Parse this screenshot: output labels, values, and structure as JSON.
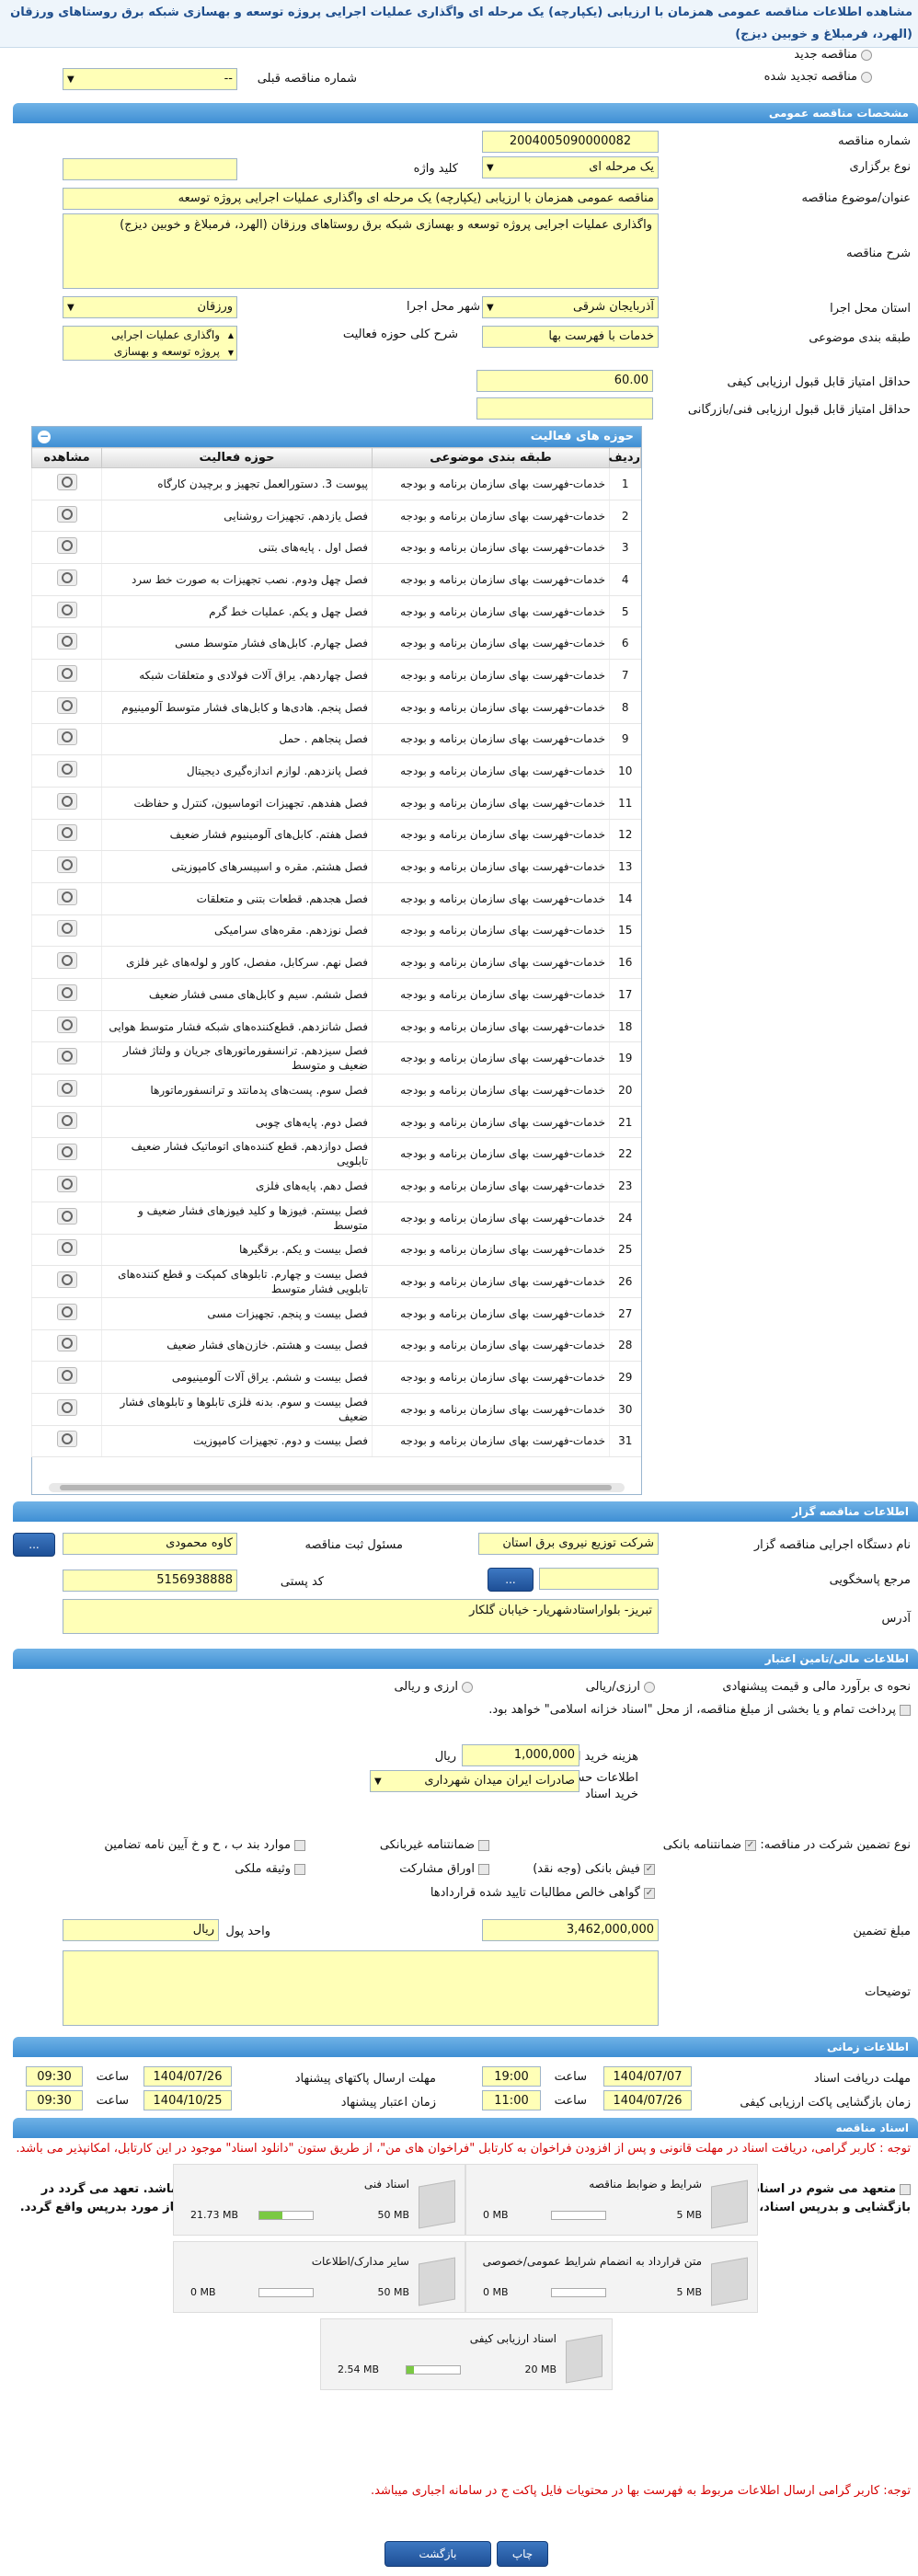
{
  "title": "مشاهده اطلاعات مناقصه عمومی همزمان با ارزیابی (یکپارچه) یک مرحله ای واگذاری عملیات اجرایی پروژه توسعه و بهسازی شبکه برق روستاهای ورزقان (الهرد، فرمبلاغ و خوبین دیزج)",
  "top": {
    "new_tender": "مناقصه جدید",
    "renewed_tender": "مناقصه تجدید شده",
    "prev_number_label": "شماره مناقصه قبلی",
    "prev_number_value": "--"
  },
  "general": {
    "section": "مشخصات مناقصه عمومی",
    "number_label": "شماره مناقصه",
    "number": "2004005090000082",
    "type_label": "نوع برگزاری",
    "type": "یک مرحله ای",
    "keyword_label": "کلید واژه",
    "subject_label": "عنوان/موضوع مناقصه",
    "subject": "مناقصه عمومی همزمان با ارزیابی (یکپارچه) یک مرحله ای واگذاری عملیات اجرایی پروژه توسعه",
    "desc_label": "شرح مناقصه",
    "desc": "واگذاری عملیات اجرایی پروژه توسعه و بهسازی شبکه برق روستاهای ورزقان (الهرد، فرمبلاغ و خوبین دیزج)",
    "province_label": "استان محل اجرا",
    "province": "آذربایجان شرقی",
    "city_label": "شهر محل اجرا",
    "city": "ورزقان",
    "category_label": "طبقه بندی موضوعی",
    "category": "خدمات با فهرست بها",
    "scope_label": "شرح کلی حوزه فعالیت",
    "scope_1": "واگذاری عملیات اجرایی",
    "scope_2": "پروژه توسعه و بهسازی",
    "min_quality_label": "حداقل امتیاز قابل قبول ارزیابی کیفی",
    "min_quality": "60.00",
    "min_tech_label": "حداقل امتیاز قابل قبول ارزیابی فنی/بازرگانی"
  },
  "activities": {
    "title": "حوزه های فعالیت",
    "col_row": "ردیف",
    "col_category": "طبقه بندی موضوعی",
    "col_field": "حوزه فعالیت",
    "col_view": "مشاهده",
    "category_text": "خدمات-فهرست بهای سازمان برنامه و بودجه",
    "rows": [
      {
        "n": "1",
        "f": "پیوست 3. دستورالعمل تجهیز و برچیدن کارگاه"
      },
      {
        "n": "2",
        "f": "فصل یازدهم. تجهیزات روشنایی"
      },
      {
        "n": "3",
        "f": "فصل اول . پایه‌های بتنی"
      },
      {
        "n": "4",
        "f": "فصل چهل ودوم. نصب تجهیزات به صورت خط سرد"
      },
      {
        "n": "5",
        "f": "فصل چهل و یکم. عملیات خط گرم"
      },
      {
        "n": "6",
        "f": "فصل چهارم. کابل‌های فشار متوسط مسی"
      },
      {
        "n": "7",
        "f": "فصل چهاردهم. یراق آلات فولادی و متعلقات شبکه"
      },
      {
        "n": "8",
        "f": "فصل پنجم. هادی‌ها و کابل‌های فشار متوسط آلومینیوم"
      },
      {
        "n": "9",
        "f": "فصل پنجاهم . حمل"
      },
      {
        "n": "10",
        "f": "فصل پانزدهم. لوازم اندازه‌گیری دیجیتال"
      },
      {
        "n": "11",
        "f": "فصل هفدهم. تجهیزات اتوماسیون، کنترل و حفاظت"
      },
      {
        "n": "12",
        "f": "فصل هفتم. کابل‌های آلومینیوم فشار ضعیف"
      },
      {
        "n": "13",
        "f": "فصل هشتم. مقره و اسپیسرهای کامپوزیتی"
      },
      {
        "n": "14",
        "f": "فصل هجدهم. قطعات بتنی و متعلقات"
      },
      {
        "n": "15",
        "f": "فصل نوزدهم. مقره‌های سرامیکی"
      },
      {
        "n": "16",
        "f": "فصل نهم. سرکابل، مفصل، کاور و لوله‌های غیر فلزی"
      },
      {
        "n": "17",
        "f": "فصل ششم. سیم و کابل‌های مسی فشار ضعیف"
      },
      {
        "n": "18",
        "f": "فصل شانزدهم. قطع‌کننده‌های شبکه فشار متوسط هوایی"
      },
      {
        "n": "19",
        "f": "فصل سیزدهم. ترانسفورماتورهای جریان و ولتاژ فشار ضعیف و متوسط"
      },
      {
        "n": "20",
        "f": "فصل سوم. پست‌های پدمانتد و ترانسفورماتورها"
      },
      {
        "n": "21",
        "f": "فصل دوم. پایه‌های چوبی"
      },
      {
        "n": "22",
        "f": "فصل دوازدهم. قطع کننده‌های اتوماتیک فشار ضعیف تابلویی"
      },
      {
        "n": "23",
        "f": "فصل دهم. پایه‌های فلزی"
      },
      {
        "n": "24",
        "f": "فصل بیستم. فیوزها و کلید فیوزهای فشار ضعیف و متوسط"
      },
      {
        "n": "25",
        "f": "فصل بیست و یکم. برقگیرها"
      },
      {
        "n": "26",
        "f": "فصل بیست و چهارم. تابلوهای کمپکت و قطع کننده‌های تابلویی فشار متوسط"
      },
      {
        "n": "27",
        "f": "فصل بیست و پنجم. تجهیزات مسی"
      },
      {
        "n": "28",
        "f": "فصل بیست و هشتم. خازن‌های فشار ضعیف"
      },
      {
        "n": "29",
        "f": "فصل بیست و ششم. یراق آلات آلومینیومی"
      },
      {
        "n": "30",
        "f": "فصل بیست و سوم. بدنه فلزی تابلوها و تابلوهای فشار ضعیف"
      },
      {
        "n": "31",
        "f": "فصل بیست و دوم. تجهیزات کامپوزیت"
      }
    ]
  },
  "organizer": {
    "section": "اطلاعات مناقصه گزار",
    "org_label": "نام دستگاه اجرایی مناقصه گزار",
    "org": "شرکت توزیع نیروی برق استان",
    "officer_label": "مسئول ثبت مناقصه",
    "officer": "کاوه محمودی",
    "ref_label": "مرجع پاسخگویی",
    "postal_label": "کد پستی",
    "postal": "5156938888",
    "address_label": "آدرس",
    "address": "تبریز- بلواراستادشهریار- خیابان گلکار",
    "more_btn": "..."
  },
  "financial": {
    "section": "اطلاعات مالی/تامین اعتبار",
    "estimate_label": "نحوه ی برآورد مالی و قیمت پیشنهادی",
    "opt_rial": "ارزی/ریالی",
    "opt_forex": "ارزی و ریالی",
    "payment_note": "پرداخت تمام و یا بخشی از مبلغ مناقصه، از محل \"اسناد خزانه اسلامی\" خواهد بود.",
    "doc_fee_label": "هزینه خرید اسناد",
    "doc_fee": "1,000,000",
    "unit_rial": "ریال",
    "account_label": "اطلاعات حساب جهت واریز هزینه خرید اسناد",
    "account": "صادرات ایران میدان شهرداری",
    "guarantee_type_label": "نوع تضمین شرکت در مناقصه:",
    "g1": "ضمانتنامه بانکی",
    "g2": "ضمانتنامه غیربانکی",
    "g3": "موارد بند ب ، ح و خ آیین نامه تضامین",
    "g4": "فیش بانکی (وجه نقد)",
    "g5": "اوراق مشارکت",
    "g6": "وثیقه ملکی",
    "g7": "گواهی خالص مطالبات تایید شده قراردادها",
    "amount_label": "مبلغ تضمین",
    "amount": "3,462,000,000",
    "currency_label": "واحد پول",
    "currency": "ریال",
    "notes_label": "توضیحات"
  },
  "timing": {
    "section": "اطلاعات زمانی",
    "receive_label": "مهلت دریافت اسناد",
    "receive_date": "1404/07/07",
    "receive_time": "19:00",
    "send_label": "مهلت ارسال پاکتهای پیشنهاد",
    "send_date": "1404/07/26",
    "send_time": "09:30",
    "open_label": "زمان بازگشایی پاکت ارزیابی کیفی",
    "open_date": "1404/07/26",
    "open_time": "11:00",
    "valid_label": "زمان اعتبار پیشنهاد",
    "valid_date": "1404/10/25",
    "valid_time": "09:30",
    "time_label": "ساعت"
  },
  "docs": {
    "section": "اسناد مناقصه",
    "note1": "توجه : کاربر گرامی، دریافت اسناد در مهلت قانونی و پس از افزودن فراخوان به کارتابل \"فراخوان های من\"، از طریق ستون \"دانلود اسناد\" موجود در این کارتابل، امکانپذیر می باشد.",
    "note2": "متعهد می شوم در اسناد مناقصه، صرفاً بدرپس اسناد الکترونیکی پاکت های (ب) و (ج) مجهز به امضای الکترونیکی قید شده باشد. تعهد می گردد در بازگشایی و بدرپس اسناد، صرفاً اسناد الکترونیکی پاکت های پیشنهاد (ب) و (ج) مجهز به امضای الکترونیکی صاحبان امضای مجاز مورد بدرپس واقع گردد.",
    "items": [
      {
        "t": "شرایط و ضوابط مناقصه",
        "max": "5 MB",
        "cur": "0 MB",
        "pct": 0
      },
      {
        "t": "اسناد فنی",
        "max": "50 MB",
        "cur": "21.73 MB",
        "pct": 43
      },
      {
        "t": "متن قرارداد به انضمام شرایط عمومی/خصوصی",
        "max": "5 MB",
        "cur": "0 MB",
        "pct": 0
      },
      {
        "t": "سایر مدارک/اطلاعات",
        "max": "50 MB",
        "cur": "0 MB",
        "pct": 0
      },
      {
        "t": "اسناد ارزیابی کیفی",
        "max": "20 MB",
        "cur": "2.54 MB",
        "pct": 13
      }
    ],
    "note3": "توجه: کاربر گرامی ارسال اطلاعات مربوط به فهرست بها در محتویات فایل پاکت ج در سامانه اجباری میباشد."
  },
  "buttons": {
    "back": "بازگشت",
    "print": "چاپ"
  }
}
